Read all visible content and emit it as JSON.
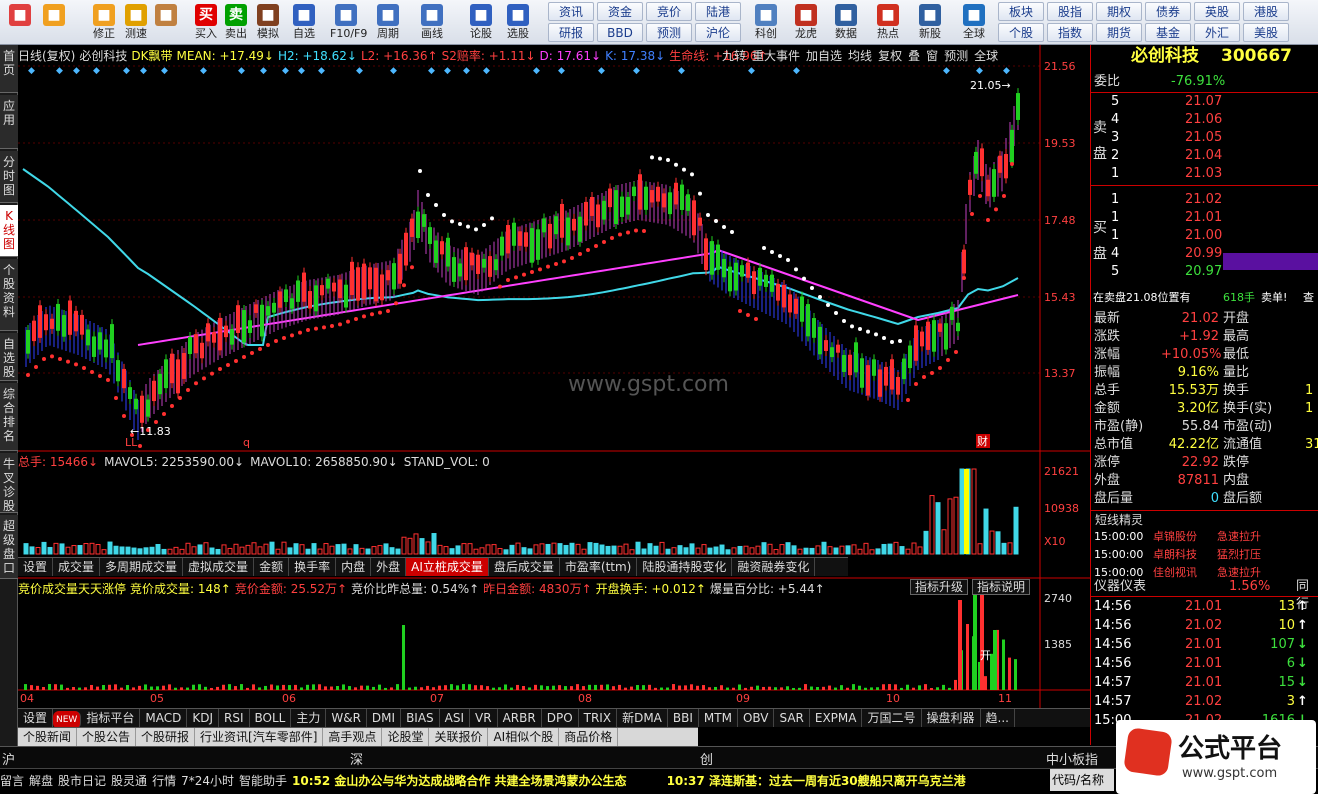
{
  "toolbar": {
    "big": [
      {
        "label": "",
        "icon": "windows-icon",
        "color": "#e04040"
      },
      {
        "label": "",
        "icon": "back-arrow-icon",
        "color": "#f0a020"
      },
      {
        "label": "修正",
        "icon": "up-arrow-icon",
        "color": "#f0a020"
      },
      {
        "label": "测速",
        "icon": "power-icon",
        "color": "#e0a000"
      },
      {
        "label": "",
        "icon": "clock-icon",
        "color": "#c08040"
      },
      {
        "label": "买入",
        "icon": "buy-icon",
        "color": "#e00000",
        "glyph": "买"
      },
      {
        "label": "卖出",
        "icon": "sell-icon",
        "color": "#00a000",
        "glyph": "卖"
      },
      {
        "label": "模拟",
        "icon": "hammer-icon",
        "color": "#804020"
      },
      {
        "label": "自选",
        "icon": "star-icon",
        "color": "#3060c0"
      },
      {
        "label": "F10/F9",
        "icon": "f10-icon",
        "color": "#4070c0"
      },
      {
        "label": "周期",
        "icon": "cycle-icon",
        "color": "#4070c0"
      },
      {
        "label": "画线",
        "icon": "pencil-icon",
        "color": "#4070c0"
      },
      {
        "label": "论股",
        "icon": "forum-icon",
        "color": "#3060c0"
      },
      {
        "label": "选股",
        "icon": "select-icon",
        "color": "#3060c0"
      }
    ],
    "grid": [
      "资讯",
      "资金",
      "竞价",
      "陆港",
      "研报",
      "BBD",
      "预测",
      "沪伦"
    ],
    "big2": [
      {
        "label": "科创",
        "icon": "chart-icon",
        "color": "#5080c0"
      },
      {
        "label": "龙虎",
        "icon": "dragon-icon",
        "color": "#c03020"
      },
      {
        "label": "数据",
        "icon": "pe-icon",
        "color": "#3060a0"
      },
      {
        "label": "热点",
        "icon": "hot-icon",
        "color": "#d03020"
      },
      {
        "label": "新股",
        "icon": "newstock-icon",
        "color": "#3060a0"
      },
      {
        "label": "全球",
        "icon": "globe-icon",
        "color": "#2070c0"
      }
    ],
    "grid2": [
      "板块",
      "股指",
      "期权",
      "债券",
      "英股",
      "港股",
      "个股",
      "指数",
      "期货",
      "基金",
      "外汇",
      "美股"
    ]
  },
  "left_tabs": [
    "首页",
    "应用",
    "分时图",
    "K线图",
    "个股资料",
    "自选股",
    "综合排名",
    "牛叉诊股",
    "超级盘口"
  ],
  "kline": {
    "indicators": [
      {
        "t": "日线(复权)",
        "c": "#dddddd"
      },
      {
        "t": "必创科技",
        "c": "#dddddd"
      },
      {
        "t": "DK飘带",
        "c": "#ffff40"
      },
      {
        "t": "MEAN: +17.49↓",
        "c": "#ffff40"
      },
      {
        "t": "H2: +18.62↓",
        "c": "#40e0ff"
      },
      {
        "t": "L2: +16.36↑",
        "c": "#ff4040"
      },
      {
        "t": "S2赔率: +1.11↓",
        "c": "#ff4040"
      },
      {
        "t": "D: 17.61↓",
        "c": "#ff40ff"
      },
      {
        "t": "K: 17.38↓",
        "c": "#4080ff"
      },
      {
        "t": "生命线: +16.96↑",
        "c": "#ff4040"
      }
    ],
    "tabs": [
      "九转",
      "重大事件",
      "加自选",
      "均线",
      "复权",
      "叠",
      "窗",
      "预测",
      "全球"
    ],
    "y_labels": [
      "21.56",
      "19.53",
      "17.48",
      "15.43",
      "13.37"
    ],
    "high_label": "21.05",
    "low_label": "11.83",
    "ll_label": "LL",
    "q_label": "q",
    "cai_label": "财",
    "watermark": "www.gspt.com"
  },
  "volume": {
    "info": [
      {
        "t": "总手: 15466↓",
        "c": "#ff4040"
      },
      {
        "t": "MAVOL5: 2253590.00↓",
        "c": "#dddddd"
      },
      {
        "t": "MAVOL10: 2658850.90↓",
        "c": "#dddddd"
      },
      {
        "t": "STAND_VOL: 0",
        "c": "#dddddd"
      }
    ],
    "y_labels": [
      "21621",
      "10938",
      "X10"
    ]
  },
  "mid_tabs": [
    "设置",
    "成交量",
    "多周期成交量",
    "虚拟成交量",
    "金额",
    "换手率",
    "内盘",
    "外盘",
    "AI立桩成交量",
    "盘后成交量",
    "市盈率(ttm)",
    "陆股通持股变化",
    "融资融券变化"
  ],
  "mid_active": "AI立桩成交量",
  "auction": {
    "info": [
      {
        "t": "竞价成交量天天涨停",
        "c": "#ffff40"
      },
      {
        "t": "竞价成交量: 148↑",
        "c": "#ffff40"
      },
      {
        "t": "竞价金额: 25.52万↑",
        "c": "#ff4040"
      },
      {
        "t": "竞价比昨总量: 0.54%↑",
        "c": "#dddddd"
      },
      {
        "t": "昨日金额: 4830万↑",
        "c": "#ff4040"
      },
      {
        "t": "开盘换手: +0.012↑",
        "c": "#ffff40"
      },
      {
        "t": "爆量百分比: +5.44↑",
        "c": "#dddddd"
      }
    ],
    "btns": [
      "指标升级",
      "指标说明"
    ],
    "y_labels": [
      "2740",
      "1385"
    ],
    "kai_label": "开",
    "months": [
      "04",
      "05",
      "06",
      "07",
      "08",
      "09",
      "10",
      "11"
    ]
  },
  "bottom_tabs": [
    "设置",
    "NEW",
    "指标平台",
    "MACD",
    "KDJ",
    "RSI",
    "BOLL",
    "主力",
    "W&R",
    "DMI",
    "BIAS",
    "ASI",
    "VR",
    "ARBR",
    "DPO",
    "TRIX",
    "新DMA",
    "BBI",
    "MTM",
    "OBV",
    "SAR",
    "EXPMA",
    "万国二号",
    "操盘利器",
    "趋..."
  ],
  "news_tabs": [
    "个股新闻",
    "个股公告",
    "个股研报",
    "行业资讯[汽车零部件]",
    "高手观点",
    "论股堂",
    "关联报价",
    "AI相似个股",
    "商品价格"
  ],
  "stock": {
    "name": "必创科技",
    "code": "300667",
    "weibi_label": "委比",
    "weibi": "-76.91%",
    "sells": [
      {
        "n": "5",
        "p": "21.07"
      },
      {
        "n": "4",
        "p": "21.06"
      },
      {
        "n": "3",
        "p": "21.05"
      },
      {
        "n": "2",
        "p": "21.04"
      },
      {
        "n": "1",
        "p": "21.03"
      }
    ],
    "buys": [
      {
        "n": "1",
        "p": "21.02"
      },
      {
        "n": "1",
        "p": "21.01"
      },
      {
        "n": "1",
        "p": "21.00"
      },
      {
        "n": "4",
        "p": "20.99"
      },
      {
        "n": "5",
        "p": "20.97"
      }
    ],
    "sell_label": "卖盘",
    "buy_label": "买盘",
    "pos_text": "在卖盘21.08位置有",
    "pos_vol": "618手",
    "pos_tag": "卖单!",
    "pos_more": "查",
    "quotes": [
      {
        "l": "最新",
        "v": "21.02",
        "c": "#ff4040",
        "l2": "开盘"
      },
      {
        "l": "涨跌",
        "v": "+1.92",
        "c": "#ff4040",
        "l2": "最高"
      },
      {
        "l": "涨幅",
        "v": "+10.05%",
        "c": "#ff4040",
        "l2": "最低"
      },
      {
        "l": "振幅",
        "v": "9.16%",
        "c": "#ffff40",
        "l2": "量比"
      },
      {
        "l": "总手",
        "v": "15.53万",
        "c": "#ffff40",
        "l2": "换手",
        "v2": "1"
      },
      {
        "l": "金额",
        "v": "3.20亿",
        "c": "#ffff40",
        "l2": "换手(实)",
        "v2": "1"
      },
      {
        "l": "市盈(静)",
        "v": "55.84",
        "c": "#dddddd",
        "l2": "市盈(动)"
      },
      {
        "l": "总市值",
        "v": "42.22亿",
        "c": "#ffff40",
        "l2": "流通值",
        "v2": "31"
      },
      {
        "l": "涨停",
        "v": "22.92",
        "c": "#ff4040",
        "l2": "跌停"
      },
      {
        "l": "外盘",
        "v": "87811",
        "c": "#ff4040",
        "l2": "内盘"
      },
      {
        "l": "盘后量",
        "v": "0",
        "c": "#40e0ff",
        "l2": "盘后额"
      }
    ],
    "sprite_title": "短线精灵",
    "sprites": [
      {
        "t": "15:00:00",
        "n": "卓锦股份",
        "e": "急速拉升"
      },
      {
        "t": "15:00:00",
        "n": "卓朗科技",
        "e": "猛烈打压"
      },
      {
        "t": "15:00:00",
        "n": "佳创视讯",
        "e": "急速拉升"
      }
    ],
    "meter_label": "仪器仪表",
    "meter_val": "1.56%",
    "meter_tag": "同行",
    "ticks": [
      {
        "t": "14:56",
        "p": "21.01",
        "v": "13",
        "d": "up"
      },
      {
        "t": "14:56",
        "p": "21.02",
        "v": "10",
        "d": "up"
      },
      {
        "t": "14:56",
        "p": "21.01",
        "v": "107",
        "d": "dn"
      },
      {
        "t": "14:56",
        "p": "21.01",
        "v": "6",
        "d": "dn"
      },
      {
        "t": "14:57",
        "p": "21.01",
        "v": "15",
        "d": "dn"
      },
      {
        "t": "14:57",
        "p": "21.02",
        "v": "3",
        "d": "up"
      },
      {
        "t": "15:00",
        "p": "21.02",
        "v": "1616",
        "d": "dn"
      }
    ]
  },
  "status": {
    "markets": [
      "沪",
      "深",
      "创",
      "中小板指"
    ],
    "left_items": [
      "留言",
      "解盘",
      "股市日记",
      "股灵通",
      "行情",
      "7*24小时",
      "智能助手"
    ],
    "news1": "10:52 金山办公与华为达成战略合作 共建全场景鸿蒙办公生态",
    "news2": "10:37 泽连斯基：过去一周有近30艘船只离开乌克兰港",
    "code_label": "代码/名称",
    "brand": "公式平台",
    "brand_url": "www.gspt.com"
  }
}
